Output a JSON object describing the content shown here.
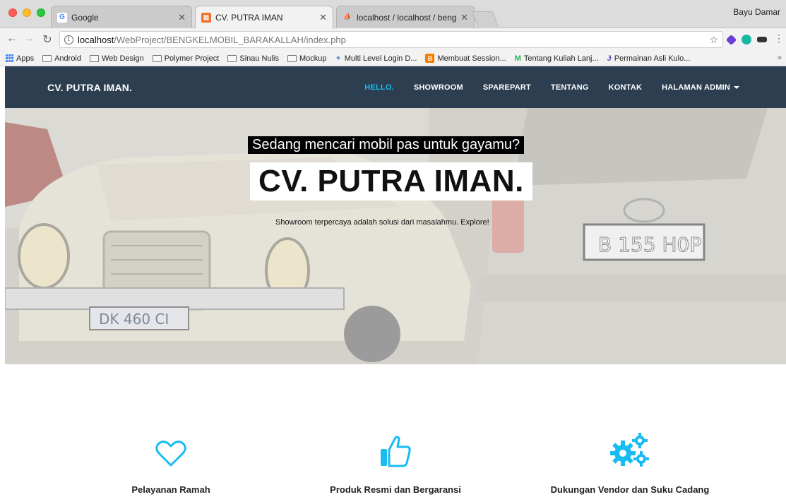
{
  "browser": {
    "tabs": [
      {
        "title": "Google",
        "favicon": "google-icon"
      },
      {
        "title": "CV. PUTRA IMAN",
        "favicon": "xampp-icon"
      },
      {
        "title": "localhost / localhost / bengkel",
        "favicon": "phpmyadmin-icon"
      }
    ],
    "profile_name": "Bayu Damar",
    "url_host": "localhost",
    "url_path": "/WebProject/BENGKELMOBIL_BARAKALLAH/index.php",
    "bookmarks": [
      "Apps",
      "Android",
      "Web Design",
      "Polymer Project",
      "Sinau Nulis",
      "Mockup",
      "Multi Level Login D...",
      "Membuat Session...",
      "Tentang Kuliah Lanj...",
      "Permainan Asli Kulo..."
    ],
    "bookmarks_more": "»"
  },
  "site": {
    "brand": "CV. PUTRA IMAN.",
    "menu": [
      "HELLO.",
      "SHOWROOM",
      "SPAREPART",
      "TENTANG",
      "KONTAK",
      "HALAMAN ADMIN"
    ],
    "hero": {
      "subtitle": "Sedang mencari mobil pas untuk gayamu?",
      "title": "CV. PUTRA IMAN.",
      "description": "Showroom terpercaya adalah solusi dari masalahmu. Explore!",
      "plates": [
        "DK 460 CI",
        "B 155 H0P"
      ]
    },
    "features": [
      {
        "label": "Pelayanan Ramah",
        "icon": "heart-icon"
      },
      {
        "label": "Produk Resmi dan Bergaransi",
        "icon": "thumbs-up-icon"
      },
      {
        "label": "Dukungan Vendor dan Suku Cadang",
        "icon": "gears-icon"
      }
    ],
    "colors": {
      "navbar": "#2c3e50",
      "accent": "#18bcf2"
    }
  }
}
